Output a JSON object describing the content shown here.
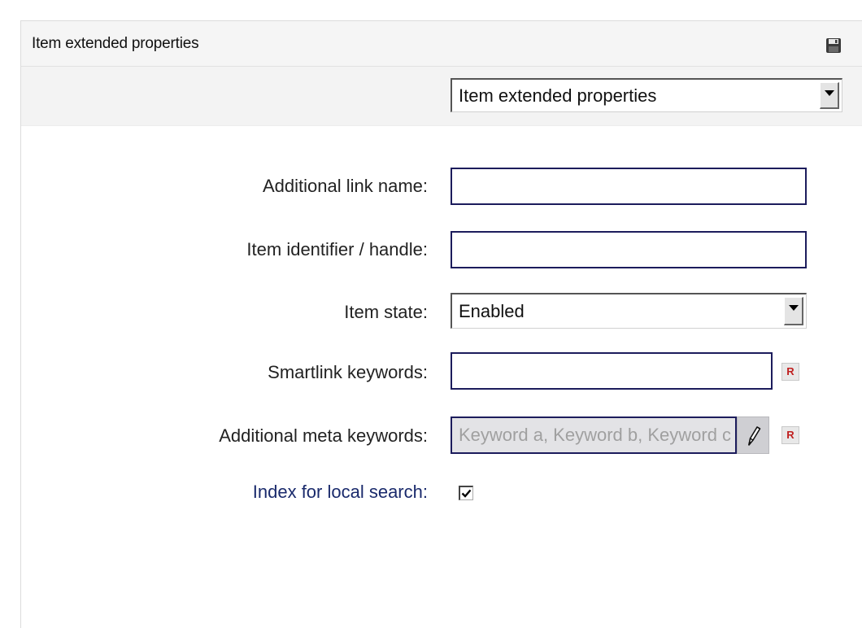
{
  "panel": {
    "title": "Item extended properties",
    "save_icon": "floppy-disk-icon"
  },
  "toolbar": {
    "view_select": {
      "selected": "Item extended properties"
    }
  },
  "form": {
    "additional_link_name": {
      "label": "Additional link name:",
      "value": ""
    },
    "item_identifier": {
      "label": "Item identifier / handle:",
      "value": ""
    },
    "item_state": {
      "label": "Item state:",
      "selected": "Enabled"
    },
    "smartlink_keywords": {
      "label": "Smartlink keywords:",
      "value": "",
      "reset_label": "R"
    },
    "meta_keywords": {
      "label": "Additional meta keywords:",
      "placeholder": "Keyword a, Keyword b, Keyword c",
      "edit_icon": "pencil-icon",
      "reset_label": "R"
    },
    "index_local_search": {
      "label": "Index for local search:",
      "checked": true
    }
  },
  "colors": {
    "input_border": "#1c1c5c",
    "link_label": "#1a2a6c",
    "reset_text": "#c02020"
  }
}
